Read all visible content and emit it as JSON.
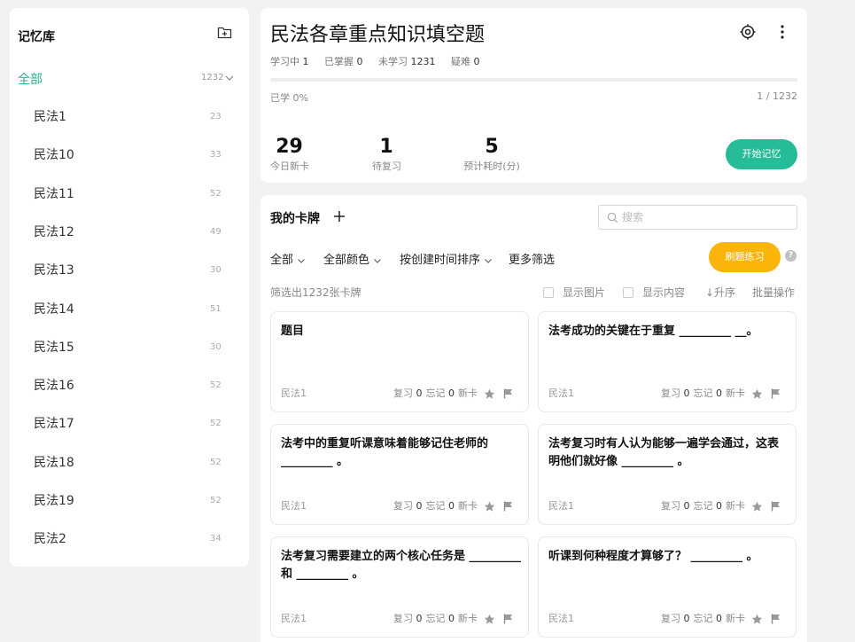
{
  "sidebar": {
    "title": "记忆库",
    "all_label": "全部",
    "all_count": "1232",
    "items": [
      {
        "label": "民法1",
        "count": "23"
      },
      {
        "label": "民法10",
        "count": "33"
      },
      {
        "label": "民法11",
        "count": "52"
      },
      {
        "label": "民法12",
        "count": "49"
      },
      {
        "label": "民法13",
        "count": "30"
      },
      {
        "label": "民法14",
        "count": "51"
      },
      {
        "label": "民法15",
        "count": "30"
      },
      {
        "label": "民法16",
        "count": "52"
      },
      {
        "label": "民法17",
        "count": "52"
      },
      {
        "label": "民法18",
        "count": "52"
      },
      {
        "label": "民法19",
        "count": "52"
      },
      {
        "label": "民法2",
        "count": "34"
      }
    ]
  },
  "header": {
    "title": "民法各章重点知识填空题",
    "stats": {
      "learning_label": "学习中",
      "learning_value": "1",
      "mastered_label": "已掌握",
      "mastered_value": "0",
      "unlearned_label": "未学习",
      "unlearned_value": "1231",
      "difficult_label": "疑难",
      "difficult_value": "0"
    },
    "progress_fraction": 0,
    "learned_text": "已学 0%",
    "page_text": "1 / 1232",
    "metrics": [
      {
        "value": "29",
        "label": "今日新卡"
      },
      {
        "value": "1",
        "label": "待复习"
      },
      {
        "value": "5",
        "label": "预计耗时(分)"
      }
    ],
    "start_button": "开始记忆"
  },
  "cards_panel": {
    "title": "我的卡牌",
    "search_placeholder": "搜索",
    "filters": {
      "all": "全部",
      "color": "全部颜色",
      "sort": "按创建时间排序",
      "more": "更多筛选"
    },
    "practice_button": "刷题练习",
    "help": "?",
    "count_text": "筛选出1232张卡牌",
    "show_image": "显示图片",
    "show_content": "显示内容",
    "ascending": "↓升序",
    "batch": "批量操作",
    "cards": [
      {
        "text": "题目",
        "deck": "民法1",
        "review_label": "复习",
        "review": "0",
        "forget_label": "忘记",
        "forget": "0",
        "status": "新卡"
      },
      {
        "text": "法考成功的关键在于重复 _________ __。",
        "deck": "民法1",
        "review_label": "复习",
        "review": "0",
        "forget_label": "忘记",
        "forget": "0",
        "status": "新卡"
      },
      {
        "text": "法考中的重复听课意味着能够记住老师的_________ 。",
        "deck": "民法1",
        "review_label": "复习",
        "review": "0",
        "forget_label": "忘记",
        "forget": "0",
        "status": "新卡"
      },
      {
        "text": "法考复习时有人认为能够一遍学会通过，这表明他们就好像 _________ 。",
        "deck": "民法1",
        "review_label": "复习",
        "review": "0",
        "forget_label": "忘记",
        "forget": "0",
        "status": "新卡"
      },
      {
        "text": "法考复习需要建立的两个核心任务是 _________ 和 _________ 。",
        "deck": "民法1",
        "review_label": "复习",
        "review": "0",
        "forget_label": "忘记",
        "forget": "0",
        "status": "新卡"
      },
      {
        "text": "听课到何种程度才算够了？ _________ 。",
        "deck": "民法1",
        "review_label": "复习",
        "review": "0",
        "forget_label": "忘记",
        "forget": "0",
        "status": "新卡"
      }
    ]
  },
  "colors": {
    "accent_green": "#25b58e",
    "practice_yellow": "#fbb40a",
    "background": "#f2f2f3"
  }
}
